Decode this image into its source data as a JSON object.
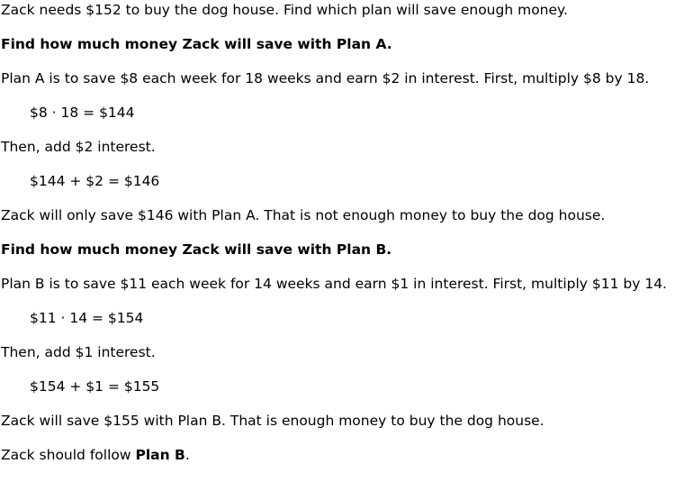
{
  "intro": "Zack needs $152 to buy the dog house. Find which plan will save enough money.",
  "plan_a": {
    "heading": "Find how much money Zack will save with Plan A.",
    "description": "Plan A is to save $8 each week for 18 weeks and earn $2 in interest. First, multiply $8 by 18.",
    "equation_1": "$8 · 18 = $144",
    "step_2": "Then, add $2 interest.",
    "equation_2": "$144 + $2 = $146",
    "conclusion": "Zack will only save $146 with Plan A. That is not enough money to buy the dog house."
  },
  "plan_b": {
    "heading": "Find how much money Zack will save with Plan B.",
    "description": "Plan B is to save $11 each week for 14 weeks and earn $1 in interest. First, multiply $11 by 14.",
    "equation_1": "$11 · 14 = $154",
    "step_2": "Then, add $1 interest.",
    "equation_2": "$154 + $1 = $155",
    "conclusion": "Zack will save $155 with Plan B. That is enough money to buy the dog house."
  },
  "final": {
    "prefix": "Zack should follow ",
    "answer": "Plan B",
    "suffix": "."
  }
}
